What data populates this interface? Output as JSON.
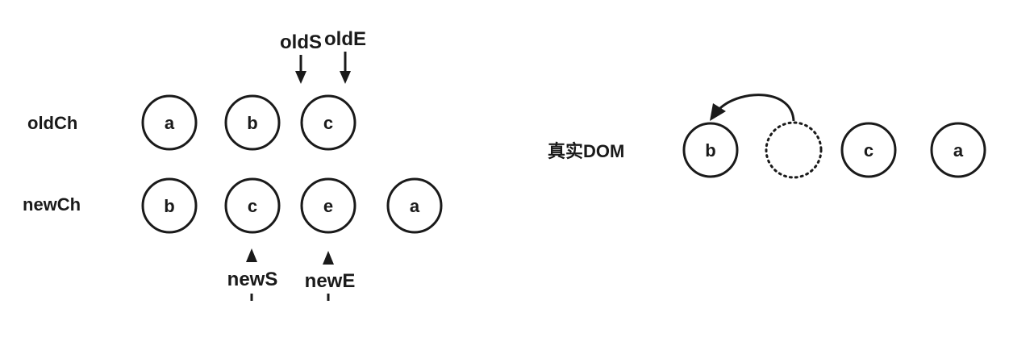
{
  "rows": {
    "old_label": "oldCh",
    "new_label": "newCh"
  },
  "old_children": [
    "a",
    "b",
    "c"
  ],
  "new_children": [
    "b",
    "c",
    "e",
    "a"
  ],
  "pointers": {
    "old_start": "oldS",
    "old_end": "oldE",
    "new_start": "newS",
    "new_end": "newE"
  },
  "real_dom": {
    "label": "真实DOM",
    "nodes": [
      "b",
      "",
      "c",
      "a"
    ],
    "empty_slot_style": "dotted"
  },
  "colors": {
    "stroke": "#1a1a1a",
    "background": "#ffffff"
  }
}
